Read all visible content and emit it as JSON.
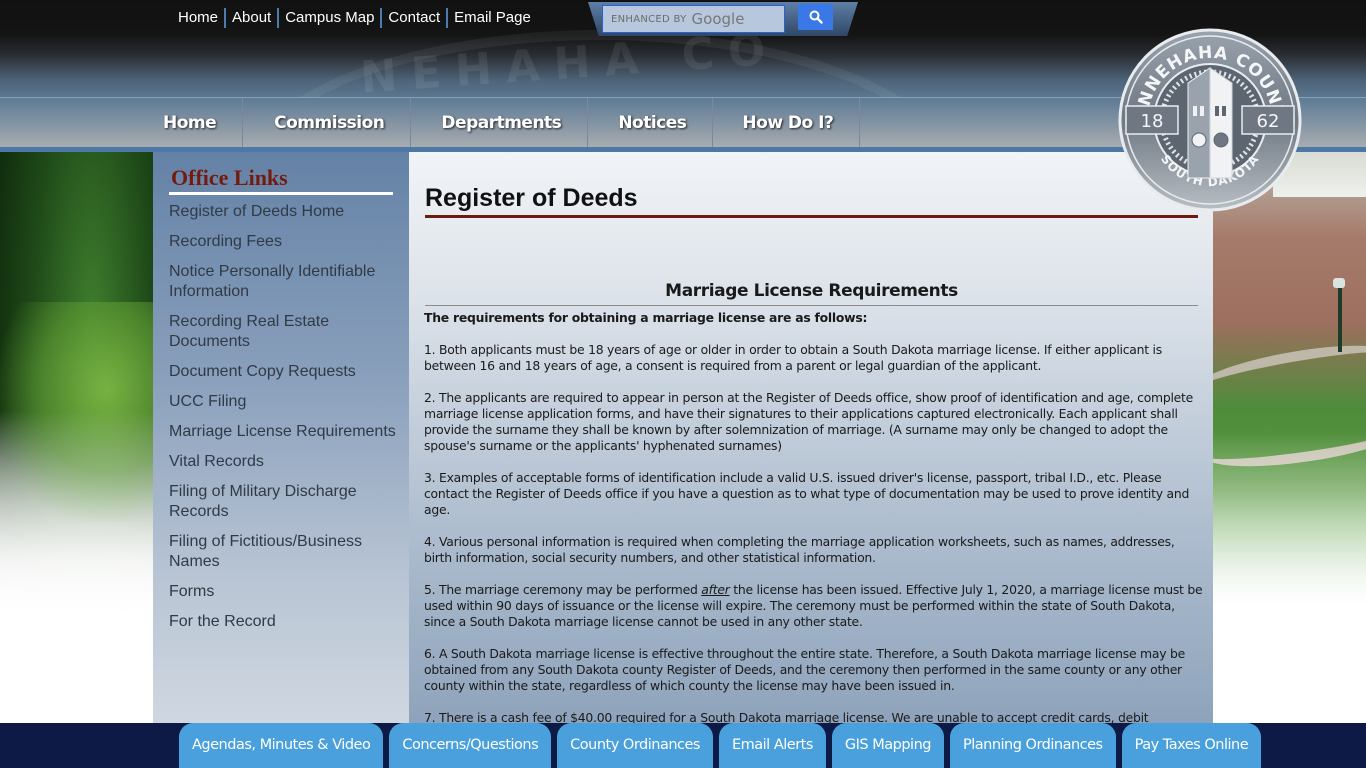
{
  "utility_nav": {
    "items": [
      "Home",
      "About",
      "Campus Map",
      "Contact",
      "Email Page"
    ]
  },
  "search": {
    "placeholder_prefix": "ENHANCED BY",
    "placeholder_brand": "Google",
    "button_icon": "search-icon",
    "button_color": "#3b78e7"
  },
  "main_nav": {
    "items": [
      "Home",
      "Commission",
      "Departments",
      "Notices",
      "How Do I?"
    ]
  },
  "seal": {
    "top_text": "MINNEHAHA COUNTY",
    "bottom_text": "SOUTH DAKOTA",
    "year_left": "18",
    "year_right": "62"
  },
  "sidebar": {
    "title": "Office Links",
    "items": [
      "Register of Deeds Home",
      "Recording Fees",
      "Notice Personally Identifiable Information",
      "Recording Real Estate Documents",
      "Document Copy Requests",
      "UCC Filing",
      "Marriage License Requirements",
      "Vital Records",
      "Filing of Military Discharge Records",
      "Filing of Fictitious/Business Names",
      "Forms",
      "For the Record"
    ]
  },
  "content": {
    "page_title": "Register of Deeds",
    "section_heading": "Marriage License Requirements",
    "intro": "The requirements for obtaining a marriage license are as follows:",
    "paragraphs": [
      "1. Both applicants must be 18 years of age or older in order to obtain a South Dakota marriage license.  If either applicant is between 16 and 18 years of age, a consent is required from a parent or legal guardian of the applicant.",
      "2. The applicants are required to appear in person at the Register of Deeds office, show proof of identification and age, complete marriage license application forms, and have their signatures to their applications captured electronically. Each applicant shall provide the surname they shall be known by after solemnization of marriage. (A surname may only be changed to adopt the spouse's surname or the applicants' hyphenated surnames)",
      "3. Examples of acceptable forms of identification include a valid U.S. issued driver's license, passport, tribal I.D., etc. Please contact the Register of Deeds office if you have a question as to what type of documentation may be used to prove identity and age.",
      "4. Various personal information is required when completing the marriage application worksheets, such as names, addresses, birth information, social security numbers, and other statistical information."
    ],
    "p5_prefix": "5. The marriage ceremony may be performed ",
    "p5_emphasis": "after",
    "p5_suffix": " the license has been issued.  Effective July 1, 2020, a marriage license must be used within 90 days of issuance or the license will expire.  The ceremony must be performed within the state of South Dakota, since a South Dakota marriage license cannot be used in any other state.",
    "p6": "6. A South Dakota marriage license is effective throughout the entire state.   Therefore, a South Dakota marriage license may be obtained from any South Dakota county  Register of Deeds, and the ceremony then performed in the same county or any other county within the state, regardless of which county the license may have been issued in.",
    "p7": "7. There is a cash fee of $40.00 required for a South Dakota marriage license.  We are unable to accept credit cards, debit"
  },
  "footer": {
    "links": [
      "Agendas, Minutes & Video",
      "Concerns/Questions",
      "County Ordinances",
      "Email Alerts",
      "GIS Mapping",
      "Planning Ordinances",
      "Pay Taxes Online"
    ]
  },
  "colors": {
    "accent_maroon": "#731b11",
    "nav_blue": "#4c78a8",
    "footer_navy": "#0c1a45",
    "footer_button": "#49a0dd"
  }
}
